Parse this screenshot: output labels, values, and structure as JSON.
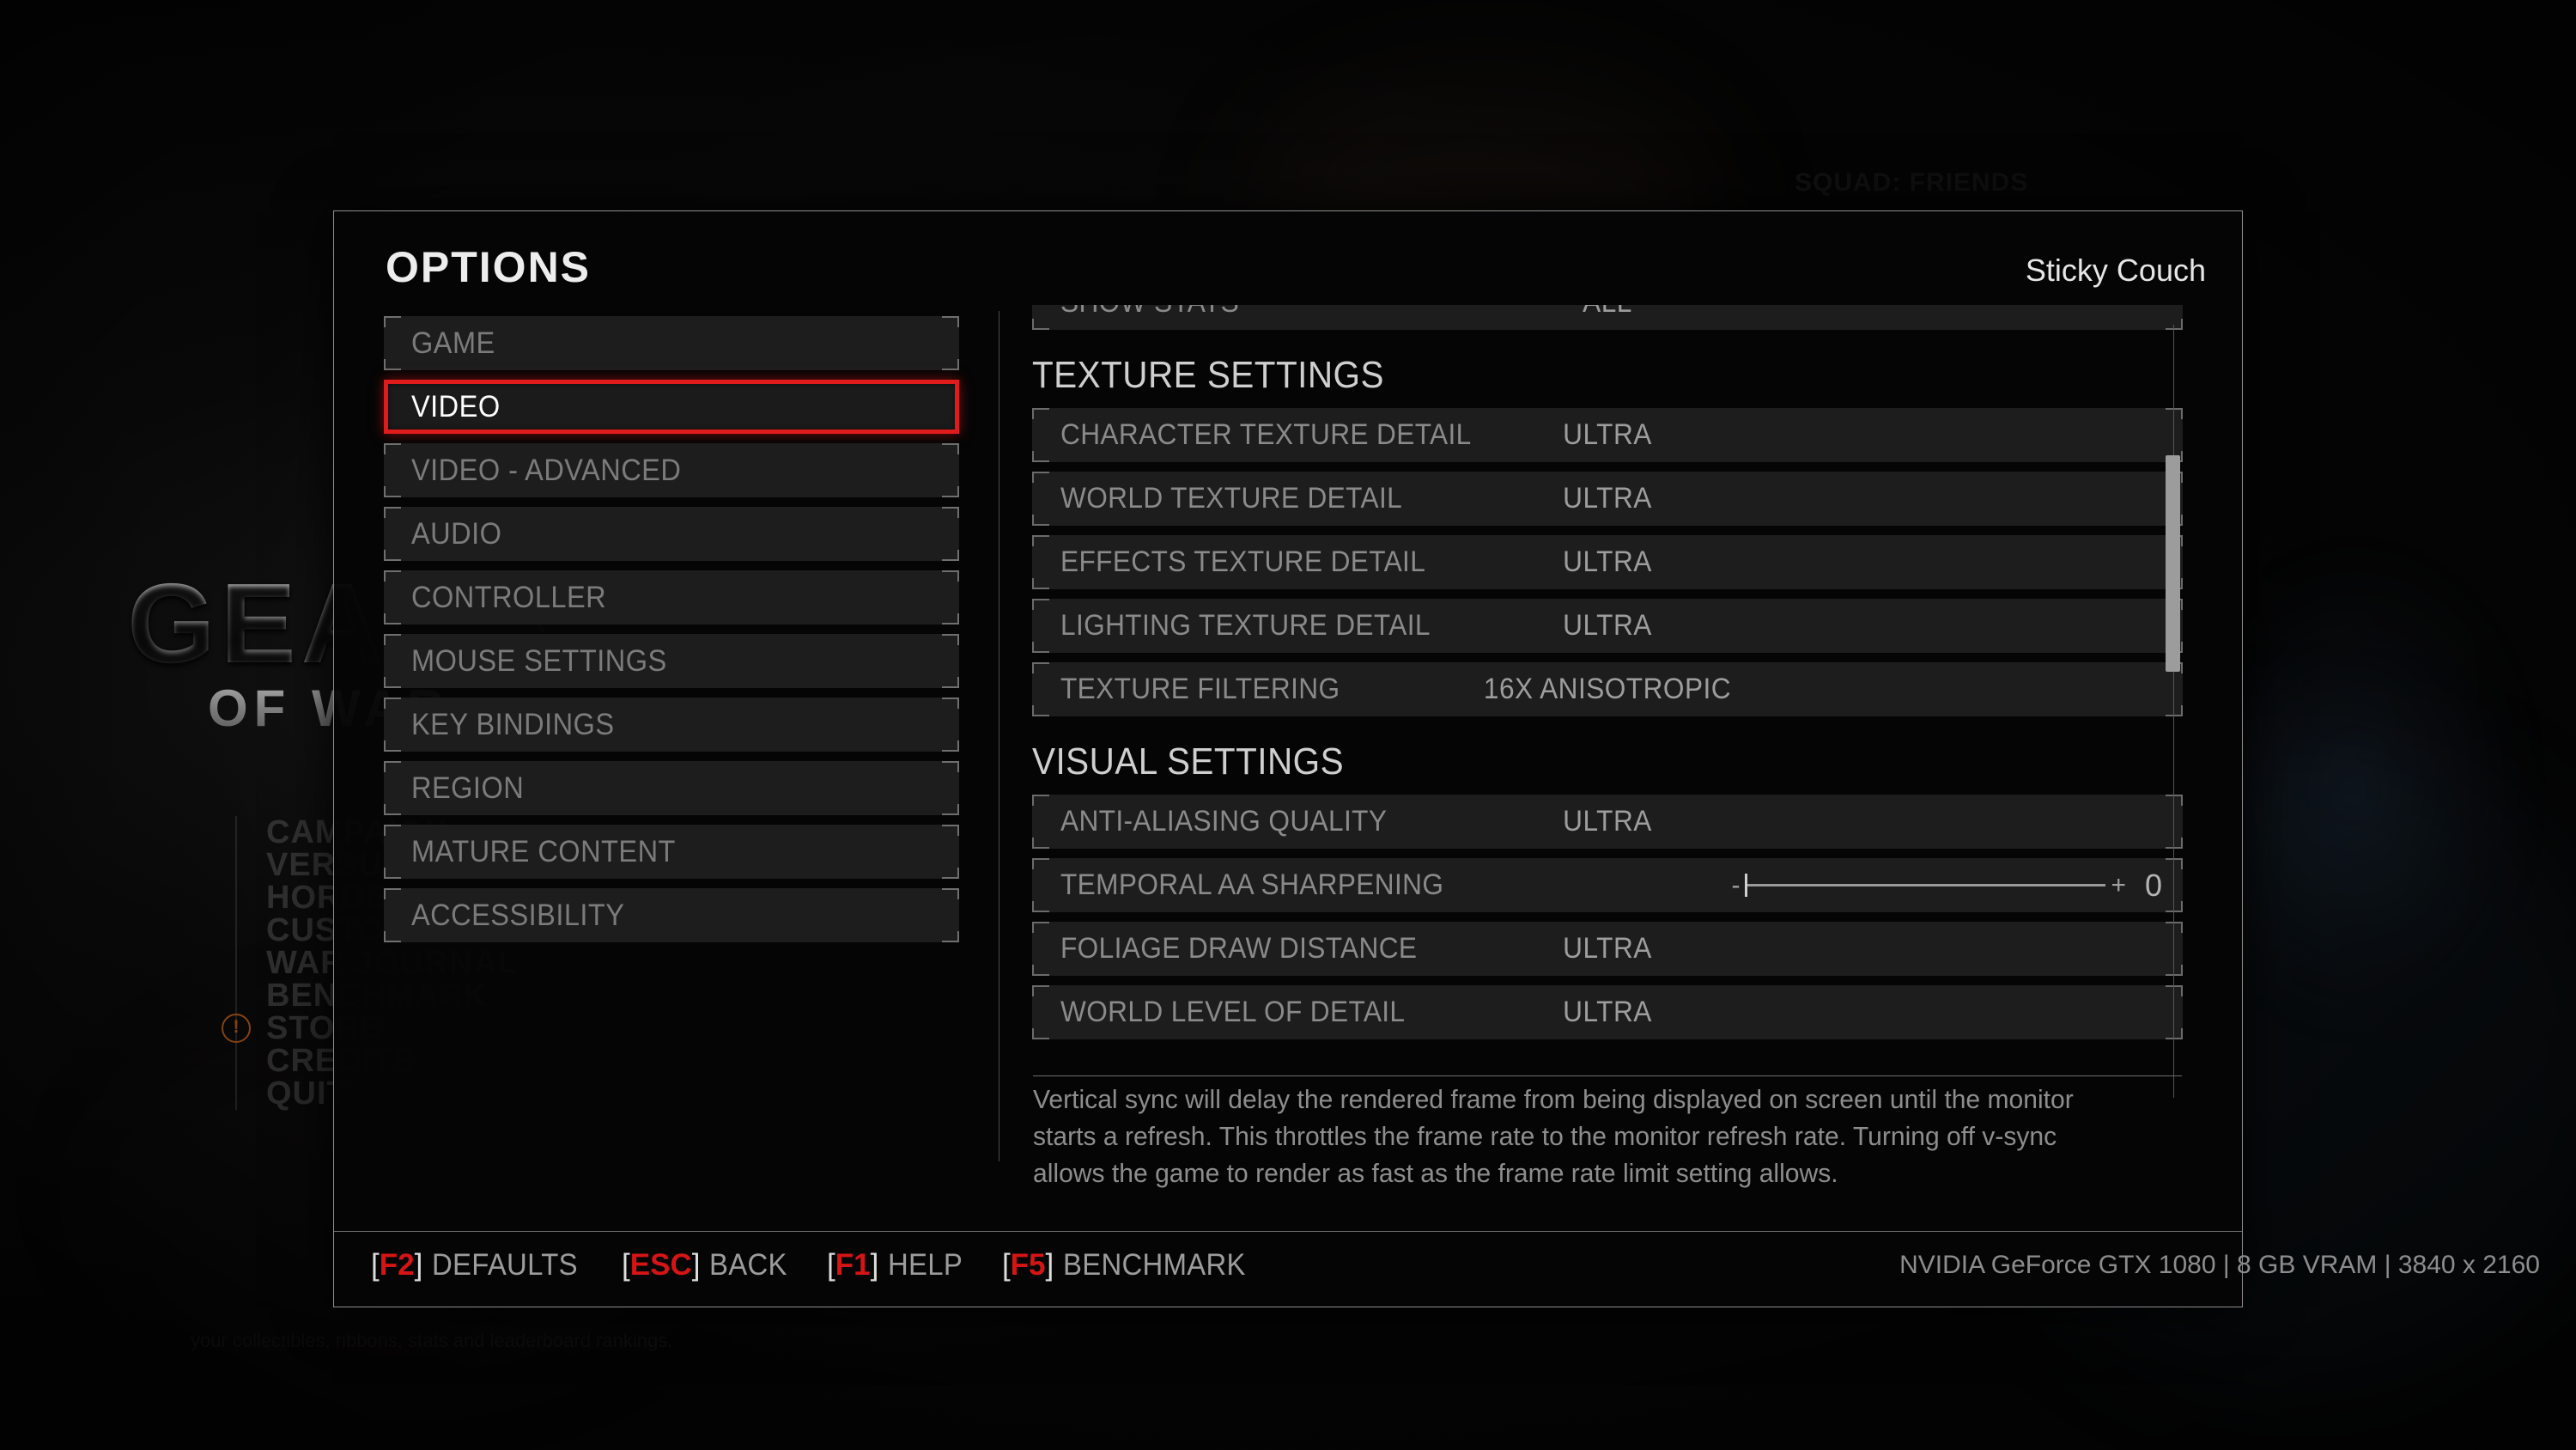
{
  "background": {
    "logo_line1": "GEARS",
    "logo_line2": "OF WAR",
    "squad_label": "SQUAD: FRIENDS",
    "footer_text": "your collectibles, ribbons, stats and leaderboard rankings.",
    "menu_items": [
      {
        "label": "CAMPAIGN",
        "warning": false
      },
      {
        "label": "VERSUS",
        "warning": false
      },
      {
        "label": "HORDE",
        "warning": false
      },
      {
        "label": "CUSTOM",
        "warning": false
      },
      {
        "label": "WAR JOURNAL",
        "warning": false
      },
      {
        "label": "BENCHMARK",
        "warning": false
      },
      {
        "label": "STORE",
        "warning": true
      },
      {
        "label": "CREDITS",
        "warning": false
      },
      {
        "label": "QUIT",
        "warning": false
      }
    ],
    "warning_icon": "exclamation-circle-icon"
  },
  "dialog": {
    "title": "OPTIONS",
    "user": "Sticky Couch"
  },
  "nav": {
    "items": [
      {
        "label": "GAME",
        "selected": false
      },
      {
        "label": "VIDEO",
        "selected": true
      },
      {
        "label": "VIDEO - ADVANCED",
        "selected": false
      },
      {
        "label": "AUDIO",
        "selected": false
      },
      {
        "label": "CONTROLLER",
        "selected": false
      },
      {
        "label": "MOUSE SETTINGS",
        "selected": false
      },
      {
        "label": "KEY BINDINGS",
        "selected": false
      },
      {
        "label": "REGION",
        "selected": false
      },
      {
        "label": "MATURE CONTENT",
        "selected": false
      },
      {
        "label": "ACCESSIBILITY",
        "selected": false
      }
    ]
  },
  "settings": {
    "rows": [
      {
        "type": "value",
        "label": "SHOW STATS",
        "value": "ALL",
        "clipped": "top"
      },
      {
        "type": "section",
        "label": "TEXTURE SETTINGS"
      },
      {
        "type": "value",
        "label": "CHARACTER TEXTURE DETAIL",
        "value": "ULTRA"
      },
      {
        "type": "value",
        "label": "WORLD TEXTURE DETAIL",
        "value": "ULTRA"
      },
      {
        "type": "value",
        "label": "EFFECTS TEXTURE DETAIL",
        "value": "ULTRA"
      },
      {
        "type": "value",
        "label": "LIGHTING TEXTURE DETAIL",
        "value": "ULTRA"
      },
      {
        "type": "value",
        "label": "TEXTURE FILTERING",
        "value": "16X ANISOTROPIC"
      },
      {
        "type": "section",
        "label": "VISUAL SETTINGS"
      },
      {
        "type": "value",
        "label": "ANTI-ALIASING QUALITY",
        "value": "ULTRA"
      },
      {
        "type": "slider",
        "label": "TEMPORAL AA SHARPENING",
        "value": "0",
        "minus": "-",
        "plus": "+",
        "percent": 0
      },
      {
        "type": "value",
        "label": "FOLIAGE DRAW DISTANCE",
        "value": "ULTRA"
      },
      {
        "type": "value",
        "label": "WORLD LEVEL OF DETAIL",
        "value": "ULTRA",
        "clipped": "bottom"
      }
    ],
    "scrollbar": {
      "name": "vertical-scrollbar"
    }
  },
  "description": "Vertical sync will delay the rendered frame from being displayed on screen until the monitor starts a refresh. This throttles the frame rate to the monitor refresh rate. Turning off v-sync allows the game to render as fast as the frame rate limit setting allows.",
  "footer": {
    "hints": [
      {
        "key": "F2",
        "action": "DEFAULTS"
      },
      {
        "key": "ESC",
        "action": "BACK"
      },
      {
        "key": "F1",
        "action": "HELP"
      },
      {
        "key": "F5",
        "action": "BENCHMARK"
      }
    ],
    "system_info": "NVIDIA GeForce GTX 1080 | 8 GB VRAM | 3840 x 2160"
  },
  "colors": {
    "accent_red": "#e01b1b",
    "key_red": "#d61414",
    "panel_bg": "#1d1d1d",
    "border_grey": "#6b6b6b",
    "text_grey": "#8a8a8a",
    "text_bright": "#ededed",
    "warning_orange": "#b05a18"
  }
}
